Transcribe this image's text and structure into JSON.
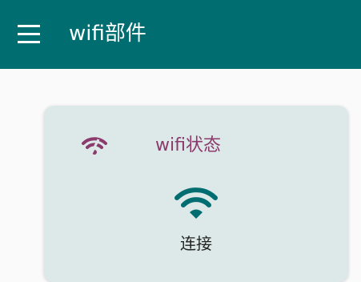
{
  "app_bar": {
    "title": "wifi部件",
    "menu_icon": "hamburger-menu-icon",
    "color": "#006e71"
  },
  "wifi_card": {
    "status_icon": "wifi-signal-icon",
    "title": "wifi状态",
    "title_color": "#8a3a6b",
    "wifi_icon": "wifi-icon",
    "wifi_icon_color": "#006e71",
    "connect_label": "连接",
    "background": "#dde9e9"
  }
}
